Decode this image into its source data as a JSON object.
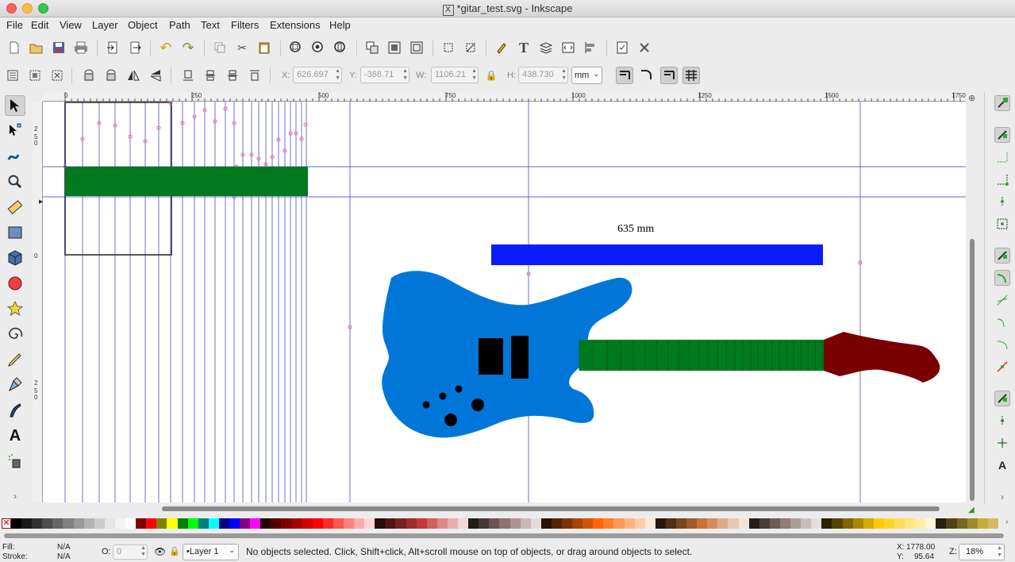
{
  "window": {
    "title_icon": "X",
    "title": "*gitar_test.svg - Inkscape",
    "traffic_lights": [
      "#fc605c",
      "#fdbc40",
      "#34c84a"
    ]
  },
  "menubar": [
    "File",
    "Edit",
    "View",
    "Layer",
    "Object",
    "Path",
    "Text",
    "Filters",
    "Extensions",
    "Help"
  ],
  "commands_bar": [
    "new-doc-icon",
    "open-icon",
    "save-icon",
    "print-icon",
    "import-icon",
    "export-icon",
    "undo-icon",
    "redo-icon",
    "duplicate-icon",
    "cut-icon",
    "paste-icon",
    "zoom-selection-icon",
    "zoom-drawing-icon",
    "zoom-page-icon",
    "group-icon",
    "ungroup-icon",
    "clone-icon",
    "node-icon",
    "text-tool-icon",
    "layers-icon",
    "xml-editor-icon",
    "align-icon",
    "doc-props-icon",
    "prefs-icon"
  ],
  "tool_controls": {
    "x_label": "X:",
    "x_value": "626.697",
    "y_label": "Y:",
    "y_value": "-368.71",
    "w_label": "W:",
    "w_value": "1106.21",
    "h_label": "H:",
    "h_value": "438.730",
    "unit": "mm"
  },
  "ruler": {
    "h_labels": [
      "0",
      "250",
      "500",
      "750",
      "1000",
      "1250",
      "1500",
      "1750"
    ],
    "v_labels": [
      "2",
      "5",
      "0",
      "0",
      "2",
      "5",
      "0"
    ]
  },
  "canvas": {
    "dimension_label": "635 mm",
    "colors": {
      "guide": "#3333bb",
      "body": "#0077d8",
      "fretboard": "#007a1e",
      "headstock": "#7a0000",
      "scale_bar": "#0a1cff",
      "pickup": "#000000",
      "node": "#e26aa0"
    }
  },
  "palette": [
    "#000000",
    "#1a1a1a",
    "#333333",
    "#4d4d4d",
    "#666666",
    "#808080",
    "#999999",
    "#b3b3b3",
    "#cccccc",
    "#e6e6e6",
    "#f2f2f2",
    "#ffffff",
    "#800000",
    "#ff0000",
    "#808000",
    "#ffff00",
    "#008000",
    "#00ff00",
    "#008080",
    "#00ffff",
    "#000080",
    "#0000ff",
    "#800080",
    "#ff00ff",
    "#2b0000",
    "#550000",
    "#800000",
    "#aa0000",
    "#d40000",
    "#ff0000",
    "#ff2a2a",
    "#ff5555",
    "#ff8080",
    "#ffaaaa",
    "#ffd5d5",
    "#280b0b",
    "#501616",
    "#782121",
    "#a02c2c",
    "#c83737",
    "#d35f5f",
    "#de8787",
    "#e9afaf",
    "#f4d7d7",
    "#241c1c",
    "#483737",
    "#6c5353",
    "#916f6f",
    "#ac9393",
    "#c8b7b7",
    "#e3dbdb",
    "#2b1100",
    "#552200",
    "#803300",
    "#aa4400",
    "#d45500",
    "#ff6600",
    "#ff7f2a",
    "#ff9955",
    "#ffb380",
    "#ffccaa",
    "#ffe6d5",
    "#28170b",
    "#502d16",
    "#784421",
    "#a05a2c",
    "#c87137",
    "#d38d5f",
    "#deaa87",
    "#e9c6af",
    "#f4e3d7",
    "#241f1c",
    "#483e37",
    "#6c5d53",
    "#917c6f",
    "#ac9d93",
    "#c8beb7",
    "#e3dedb",
    "#2b2200",
    "#554400",
    "#806600",
    "#aa8800",
    "#d4aa00",
    "#ffcc00",
    "#ffd42a",
    "#ffdd55",
    "#ffe680",
    "#ffeeaa",
    "#fff6d5",
    "#28220b",
    "#504416",
    "#786721",
    "#a0892c",
    "#c8ab37",
    "#d3bc5f"
  ],
  "statusbar": {
    "fill_label": "Fill:",
    "fill_value": "N/A",
    "stroke_label": "Stroke:",
    "stroke_value": "N/A",
    "opacity_label": "O:",
    "opacity_value": "0",
    "layer": "•Layer 1",
    "message": "No objects selected. Click, Shift+click, Alt+scroll mouse on top of objects, or drag around objects to select.",
    "coord_x_label": "X:",
    "coord_x": "1778.00",
    "coord_y_label": "Y:",
    "coord_y": "95.64",
    "zoom_label": "Z:",
    "zoom": "18%"
  }
}
